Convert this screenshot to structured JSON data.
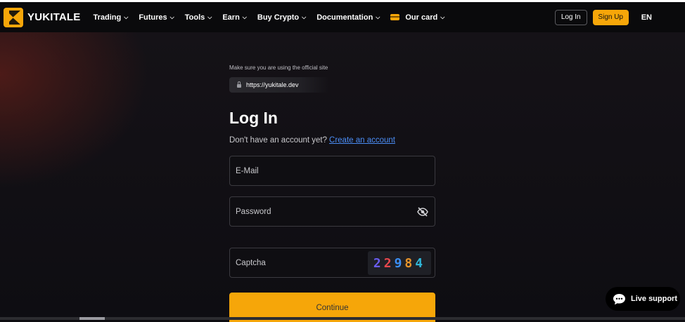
{
  "brand": {
    "name": "YUKITALE",
    "accent": "#f6a609"
  },
  "nav": {
    "items": [
      {
        "label": "Trading"
      },
      {
        "label": "Futures"
      },
      {
        "label": "Tools"
      },
      {
        "label": "Earn"
      },
      {
        "label": "Buy Crypto"
      },
      {
        "label": "Documentation"
      },
      {
        "label": "Our card"
      }
    ],
    "login_label": "Log In",
    "signup_label": "Sign Up",
    "language": "EN"
  },
  "notice": {
    "text": "Make sure you are using the official site",
    "url": "https://yukitale.dev"
  },
  "form": {
    "title": "Log In",
    "no_account_text": "Don't have an account yet?",
    "create_account_link": "Create an account",
    "email_placeholder": "E-Mail",
    "password_placeholder": "Password",
    "captcha_placeholder": "Captcha",
    "captcha_digits": [
      {
        "d": "2",
        "color": "#6a5df0"
      },
      {
        "d": "2",
        "color": "#e8474d"
      },
      {
        "d": "9",
        "color": "#3b8ef5"
      },
      {
        "d": "8",
        "color": "#e6932a"
      },
      {
        "d": "4",
        "color": "#2fb6d8"
      }
    ],
    "continue_label": "Continue"
  },
  "support": {
    "label": "Live support"
  }
}
